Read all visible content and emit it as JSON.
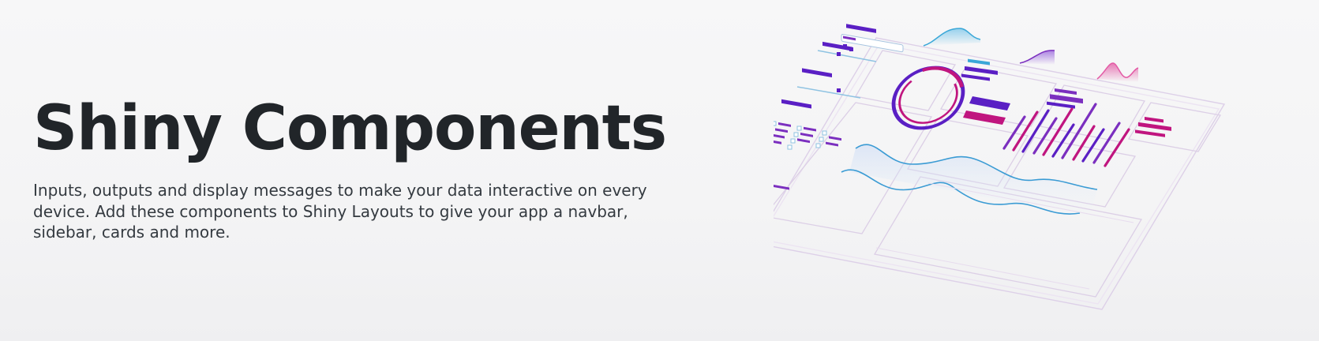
{
  "hero": {
    "title": "Shiny Components",
    "description": "Inputs, outputs and display messages to make your data interactive on every device. Add these components to Shiny Layouts to give your app a navbar, sidebar, cards and more."
  },
  "illustration": {
    "icon": "dashboard-isometric-illustration",
    "colors": {
      "purple": "#5a1fc4",
      "violet": "#7b2fbf",
      "magenta": "#c0157f",
      "blue": "#2f8fd0",
      "outline": "#dccfe6"
    }
  }
}
